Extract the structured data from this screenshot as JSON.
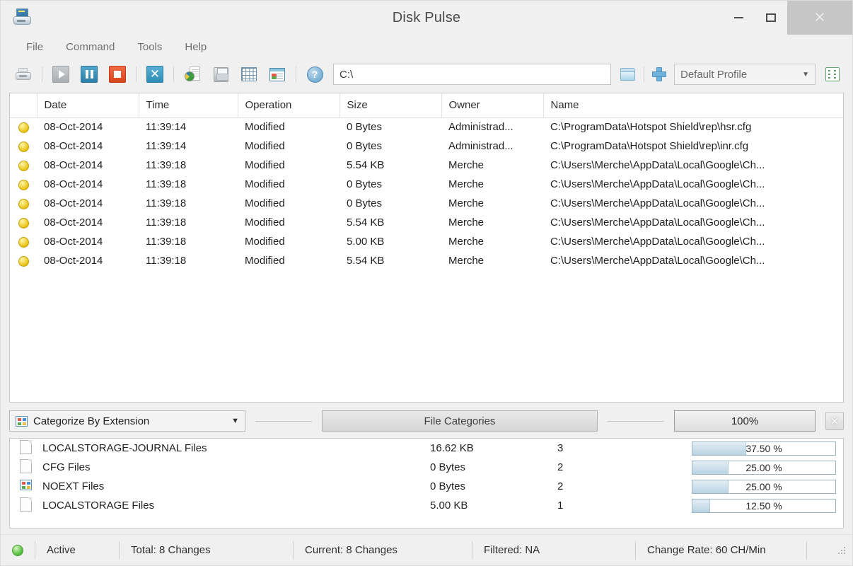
{
  "window": {
    "title": "Disk Pulse",
    "app_icon": "disk-pulse-icon",
    "minimize_label": "–",
    "maximize_label": "▭",
    "close_label": "×"
  },
  "menu": {
    "items": [
      {
        "label": "File"
      },
      {
        "label": "Command"
      },
      {
        "label": "Tools"
      },
      {
        "label": "Help"
      }
    ]
  },
  "toolbar": {
    "buttons": [
      {
        "name": "print-button",
        "icon": "printer-icon"
      },
      {
        "name": "start-button",
        "icon": "play-icon"
      },
      {
        "name": "pause-button",
        "icon": "pause-icon"
      },
      {
        "name": "stop-button",
        "icon": "stop-icon"
      },
      {
        "name": "clear-button",
        "icon": "x-icon"
      },
      {
        "name": "report-button",
        "icon": "pie-report-icon"
      },
      {
        "name": "save-button",
        "icon": "floppy-disk-icon"
      },
      {
        "name": "grid-button",
        "icon": "grid-icon"
      },
      {
        "name": "database-button",
        "icon": "database-window-icon"
      },
      {
        "name": "help-button",
        "icon": "question-mark-icon"
      }
    ],
    "path_value": "C:\\",
    "path_placeholder": "C:\\",
    "browse_icon": "folder-icon",
    "add_icon": "plus-icon",
    "profile_value": "Default Profile",
    "profile_caret": "▼",
    "options_icon": "list-options-icon"
  },
  "changes_table": {
    "columns": [
      "",
      "Date",
      "Time",
      "Operation",
      "Size",
      "Owner",
      "Name"
    ],
    "rows": [
      {
        "status": "modified",
        "date": "08-Oct-2014",
        "time": "11:39:14",
        "operation": "Modified",
        "size": "0 Bytes",
        "owner": "Administrad...",
        "name": "C:\\ProgramData\\Hotspot Shield\\rep\\hsr.cfg"
      },
      {
        "status": "modified",
        "date": "08-Oct-2014",
        "time": "11:39:14",
        "operation": "Modified",
        "size": "0 Bytes",
        "owner": "Administrad...",
        "name": "C:\\ProgramData\\Hotspot Shield\\rep\\inr.cfg"
      },
      {
        "status": "modified",
        "date": "08-Oct-2014",
        "time": "11:39:18",
        "operation": "Modified",
        "size": "5.54 KB",
        "owner": "Merche",
        "name": "C:\\Users\\Merche\\AppData\\Local\\Google\\Ch..."
      },
      {
        "status": "modified",
        "date": "08-Oct-2014",
        "time": "11:39:18",
        "operation": "Modified",
        "size": "0 Bytes",
        "owner": "Merche",
        "name": "C:\\Users\\Merche\\AppData\\Local\\Google\\Ch..."
      },
      {
        "status": "modified",
        "date": "08-Oct-2014",
        "time": "11:39:18",
        "operation": "Modified",
        "size": "0 Bytes",
        "owner": "Merche",
        "name": "C:\\Users\\Merche\\AppData\\Local\\Google\\Ch..."
      },
      {
        "status": "modified",
        "date": "08-Oct-2014",
        "time": "11:39:18",
        "operation": "Modified",
        "size": "5.54 KB",
        "owner": "Merche",
        "name": "C:\\Users\\Merche\\AppData\\Local\\Google\\Ch..."
      },
      {
        "status": "modified",
        "date": "08-Oct-2014",
        "time": "11:39:18",
        "operation": "Modified",
        "size": "5.00 KB",
        "owner": "Merche",
        "name": "C:\\Users\\Merche\\AppData\\Local\\Google\\Ch..."
      },
      {
        "status": "modified",
        "date": "08-Oct-2014",
        "time": "11:39:18",
        "operation": "Modified",
        "size": "5.54 KB",
        "owner": "Merche",
        "name": "C:\\Users\\Merche\\AppData\\Local\\Google\\Ch..."
      }
    ]
  },
  "category_bar": {
    "combo_icon": "categories-icon",
    "combo_value": "Categorize By Extension",
    "combo_caret": "▼",
    "title": "File Categories",
    "zoom_value": "100%",
    "close_label": "✕"
  },
  "categories": {
    "rows": [
      {
        "icon": "document-icon",
        "name": "LOCALSTORAGE-JOURNAL Files",
        "size": "16.62 KB",
        "count": "3",
        "percent_label": "37.50 %",
        "percent": 37.5
      },
      {
        "icon": "document-icon",
        "name": "CFG Files",
        "size": "0 Bytes",
        "count": "2",
        "percent_label": "25.00 %",
        "percent": 25.0
      },
      {
        "icon": "noext-icon",
        "name": "NOEXT Files",
        "size": "0 Bytes",
        "count": "2",
        "percent_label": "25.00 %",
        "percent": 25.0
      },
      {
        "icon": "document-icon",
        "name": "LOCALSTORAGE Files",
        "size": "5.00 KB",
        "count": "1",
        "percent_label": "12.50 %",
        "percent": 12.5
      }
    ]
  },
  "statusbar": {
    "led_color": "#56bf3e",
    "state": "Active",
    "total": "Total: 8 Changes",
    "current": "Current: 8 Changes",
    "filtered": "Filtered: NA",
    "change_rate": "Change Rate: 60 CH/Min"
  }
}
